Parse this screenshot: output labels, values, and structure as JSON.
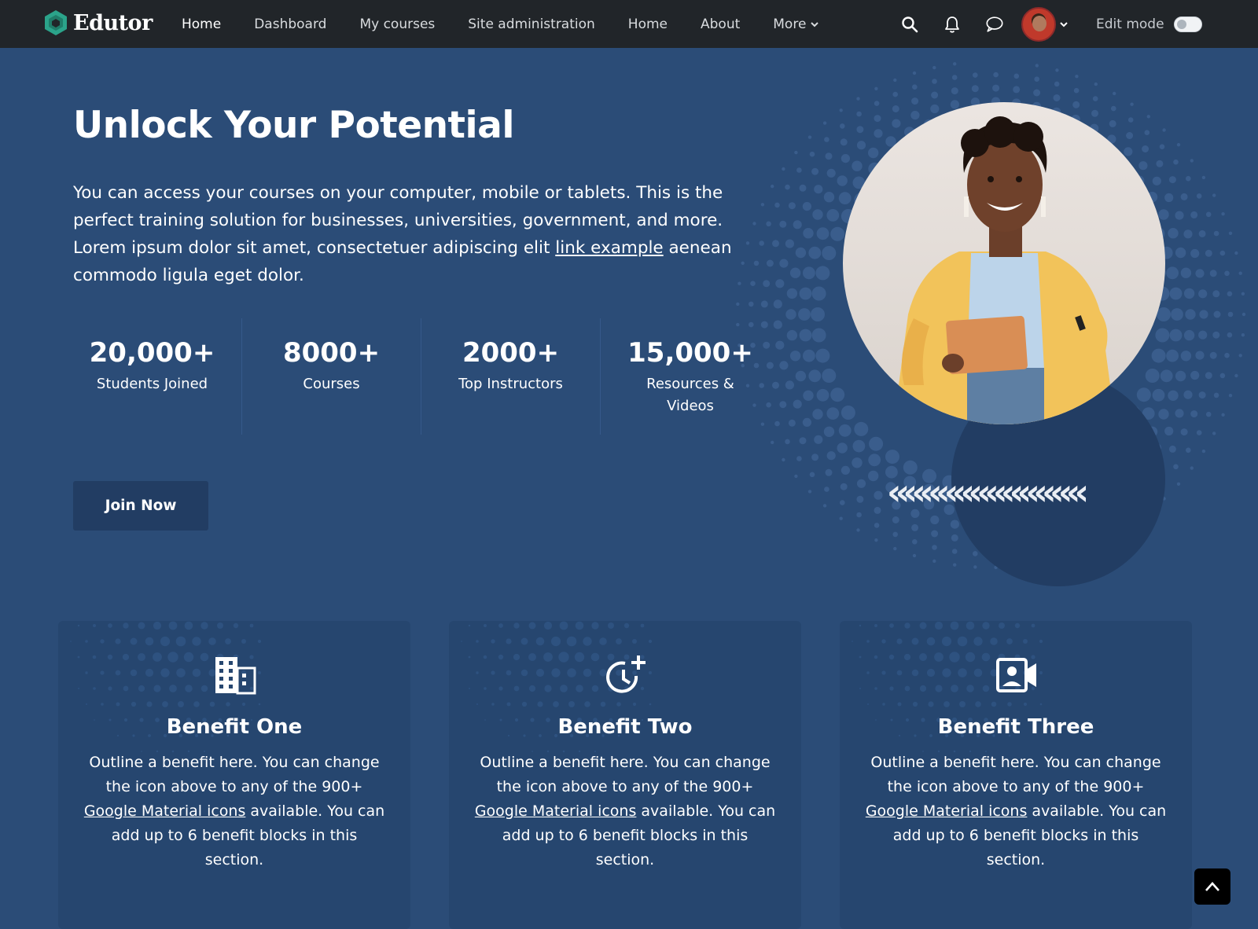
{
  "brand": {
    "name": "Edutor",
    "accent": "#2ba38a"
  },
  "nav": {
    "links": [
      "Home",
      "Dashboard",
      "My courses",
      "Site administration",
      "Home",
      "About",
      "More"
    ],
    "active_index": 0
  },
  "header_icons": [
    "search-icon",
    "bell-icon",
    "chat-icon"
  ],
  "edit_mode": {
    "label": "Edit mode",
    "on": false
  },
  "hero": {
    "title": "Unlock Your Potential",
    "text_before_link": "You can access your courses on your computer, mobile or tablets. This is the perfect training solution for businesses, universities, government, and more. Lorem ipsum dolor sit amet, consectetuer adipiscing elit ",
    "link_text": "link example",
    "text_after_link": " aenean commodo ligula eget dolor.",
    "stats": [
      {
        "number": "20,000+",
        "label": "Students Joined"
      },
      {
        "number": "8000+",
        "label": "Courses"
      },
      {
        "number": "2000+",
        "label": "Top Instructors"
      },
      {
        "number": "15,000+",
        "label": "Resources & Videos"
      }
    ],
    "cta": "Join Now",
    "chevrons": "««««««««««««"
  },
  "benefits": [
    {
      "icon": "building-icon",
      "title": "Benefit One",
      "text_before_link": "Outline a benefit here. You can change the icon above to any of the 900+ ",
      "link_text": "Google Material icons",
      "text_after_link": " available. You can add up to 6 benefit blocks in this section."
    },
    {
      "icon": "clock-plus-icon",
      "title": "Benefit Two",
      "text_before_link": "Outline a benefit here. You can change the icon above to any of the 900+ ",
      "link_text": "Google Material icons",
      "text_after_link": " available. You can add up to 6 benefit blocks in this section."
    },
    {
      "icon": "video-contact-icon",
      "title": "Benefit Three",
      "text_before_link": "Outline a benefit here. You can change the icon above to any of the 900+ ",
      "link_text": "Google Material icons",
      "text_after_link": " available. You can add up to 6 benefit blocks in this section."
    }
  ],
  "colors": {
    "page_bg": "#2b4c77",
    "navbar_bg": "#212529",
    "card_bg": "#26466f",
    "button_bg": "#223d63"
  }
}
